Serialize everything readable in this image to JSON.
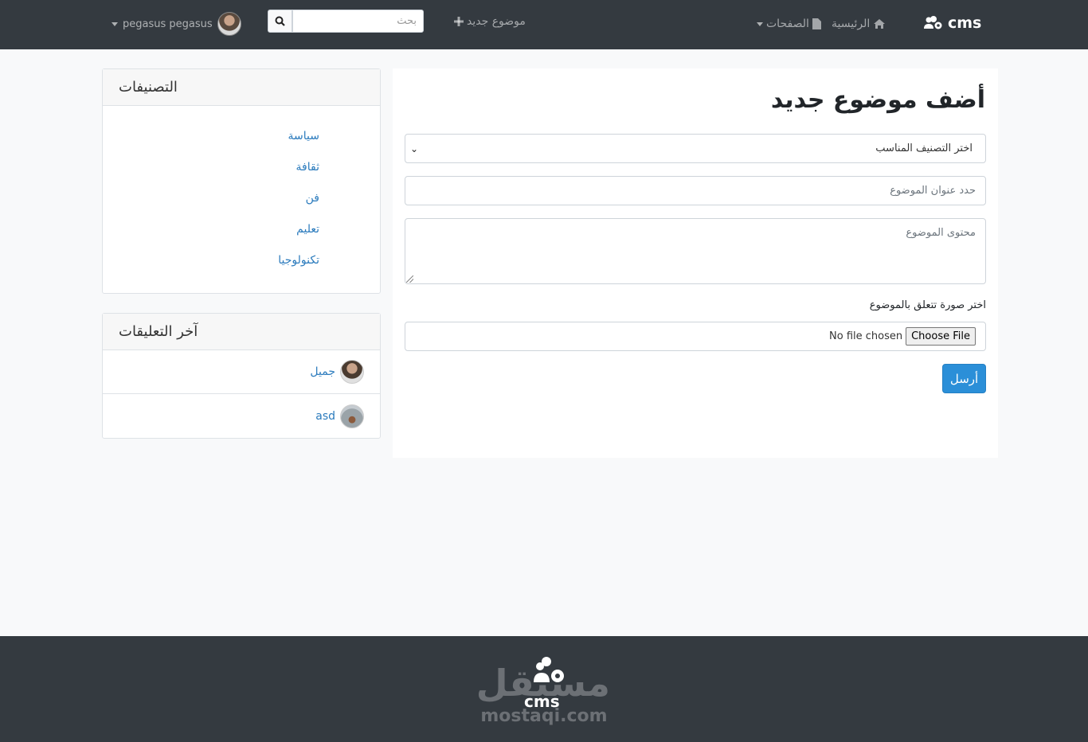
{
  "navbar": {
    "brand": "cms",
    "home_label": "الرئيسية",
    "pages_label": "الصفحات",
    "new_topic_label": "موضوع جديد",
    "search_placeholder": "بحث",
    "user_name": "pegasus pegasus"
  },
  "sidebar": {
    "categories_title": "التصنيفات",
    "categories": [
      "سياسة",
      "ثقافة",
      "فن",
      "تعليم",
      "تكنولوجيا"
    ],
    "comments_title": "آخر التعليقات",
    "comments": [
      {
        "text": "جميل"
      },
      {
        "text": "asd"
      }
    ]
  },
  "form": {
    "title": "أضف موضوع جديد",
    "category_select": "اختر التصنيف المناسب",
    "title_placeholder": "حدد عنوان الموضوع",
    "content_placeholder": "محتوى الموضوع",
    "image_label": "اختر صورة تتعلق بالموضوع",
    "file_button": "Choose File",
    "file_status": "No file chosen",
    "submit_label": "أرسل"
  },
  "footer": {
    "logo_arabic": "مستقل",
    "logo_cms": "cms",
    "logo_domain": "mostaqi.com"
  },
  "colors": {
    "navbar": "#343a40",
    "link": "#2b7bbd",
    "primary": "#2b8fd8"
  }
}
